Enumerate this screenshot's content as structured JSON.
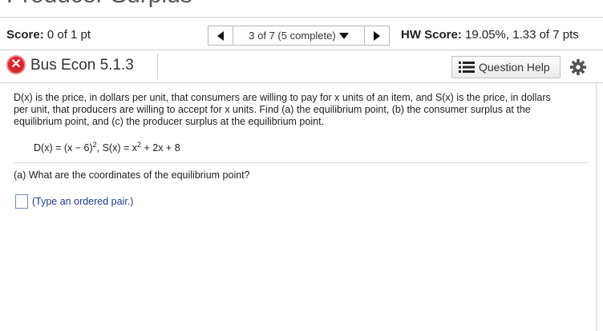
{
  "page_title": "Producer Surplus",
  "score": {
    "label": "Score:",
    "value": "0 of 1 pt"
  },
  "nav": {
    "position": "3 of 7 (5 complete)"
  },
  "hw_score": {
    "label": "HW Score:",
    "value": "19.05%, 1.33 of 7 pts"
  },
  "question": {
    "title": "Bus Econ 5.1.3",
    "help_label": "Question Help"
  },
  "problem": {
    "text": "D(x) is the price, in dollars per unit, that consumers are willing to pay for x units of an item, and S(x) is the price, in dollars per unit, that producers are willing to accept for x units. Find (a) the equilibrium point, (b) the consumer surplus at the equilibrium point, and (c) the producer surplus at the equilibrium point.",
    "formula_d": "D(x) = (x − 6)",
    "formula_d_exp": "2",
    "formula_sep": ", S(x) = x",
    "formula_s_exp": "2",
    "formula_s_rest": " + 2x + 8"
  },
  "part_a": {
    "question": "(a) What are the coordinates of the equilibrium point?",
    "hint": "(Type an ordered pair.)"
  },
  "colors": {
    "accent": "#1f3c8f",
    "error": "#d9262b"
  }
}
